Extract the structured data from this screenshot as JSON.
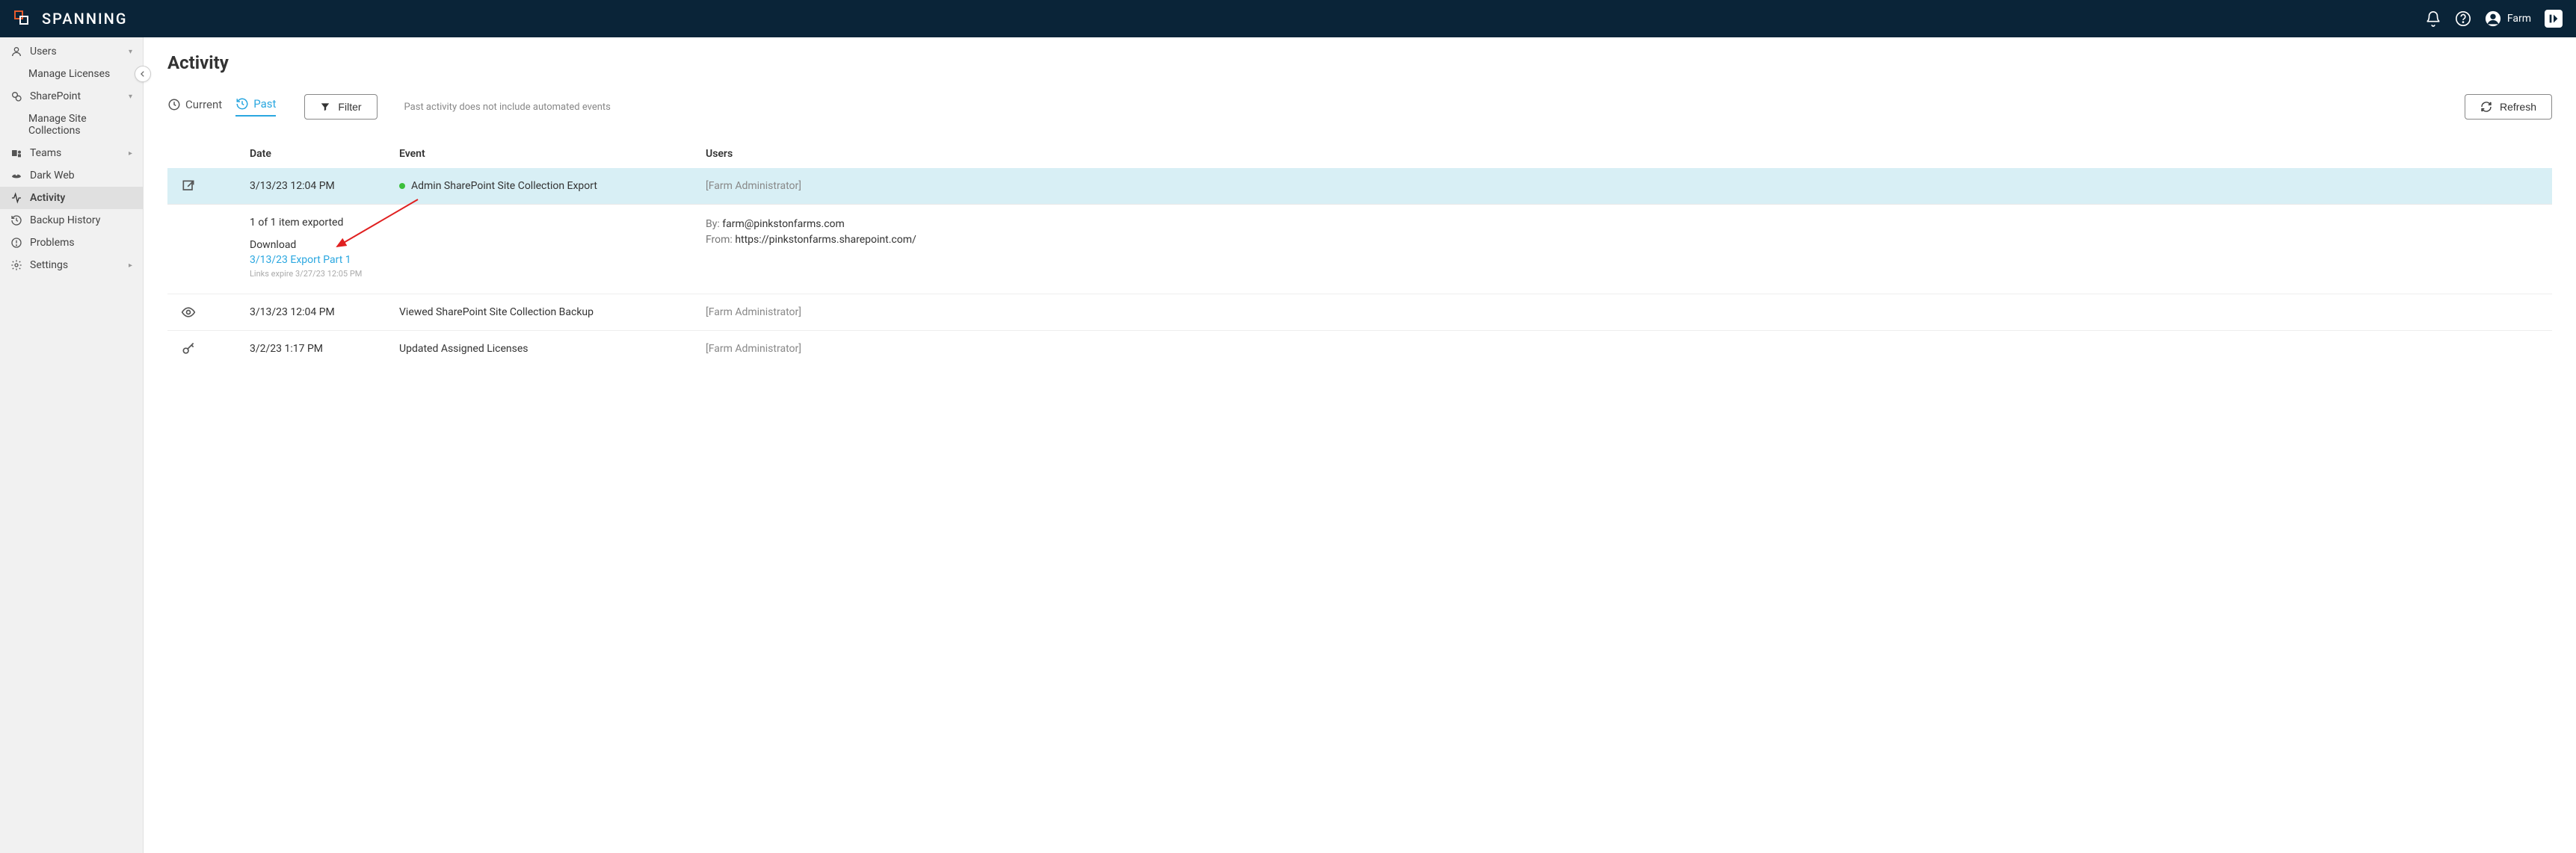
{
  "header": {
    "brand": "SPANNING",
    "user_name": "Farm",
    "app_badge": "K"
  },
  "sidebar": {
    "items": [
      {
        "label": "Users",
        "icon": "user",
        "expandable": true
      },
      {
        "label": "Manage Licenses",
        "sub": true
      },
      {
        "label": "SharePoint",
        "icon": "sharepoint",
        "expandable": true
      },
      {
        "label": "Manage Site Collections",
        "sub": true
      },
      {
        "label": "Teams",
        "icon": "teams",
        "expandable": true,
        "chev": "right"
      },
      {
        "label": "Dark Web",
        "icon": "darkweb"
      },
      {
        "label": "Activity",
        "icon": "activity",
        "active": true
      },
      {
        "label": "Backup History",
        "icon": "history"
      },
      {
        "label": "Problems",
        "icon": "problems"
      },
      {
        "label": "Settings",
        "icon": "settings",
        "expandable": true,
        "chev": "right"
      }
    ]
  },
  "page": {
    "title": "Activity"
  },
  "toolbar": {
    "tab_current": "Current",
    "tab_past": "Past",
    "filter_label": "Filter",
    "note": "Past activity does not include automated events",
    "refresh_label": "Refresh"
  },
  "table": {
    "headers": {
      "date": "Date",
      "event": "Event",
      "users": "Users"
    },
    "rows": [
      {
        "icon": "export",
        "date": "3/13/23 12:04 PM",
        "event": "Admin SharePoint Site Collection Export",
        "status": "green",
        "users": "[Farm Administrator]",
        "highlight": true,
        "expanded": {
          "summary": "1 of 1 item exported",
          "download_label": "Download",
          "download_link_text": "3/13/23 Export Part 1",
          "links_expire": "Links expire 3/27/23 12:05 PM",
          "by_label": "By:",
          "by_value": "farm@pinkstonfarms.com",
          "from_label": "From:",
          "from_value": "https://pinkstonfarms.sharepoint.com/"
        }
      },
      {
        "icon": "eye",
        "date": "3/13/23 12:04 PM",
        "event": "Viewed SharePoint Site Collection Backup",
        "users": "[Farm Administrator]"
      },
      {
        "icon": "key",
        "date": "3/2/23 1:17 PM",
        "event": "Updated Assigned Licenses",
        "users": "[Farm Administrator]"
      }
    ]
  }
}
